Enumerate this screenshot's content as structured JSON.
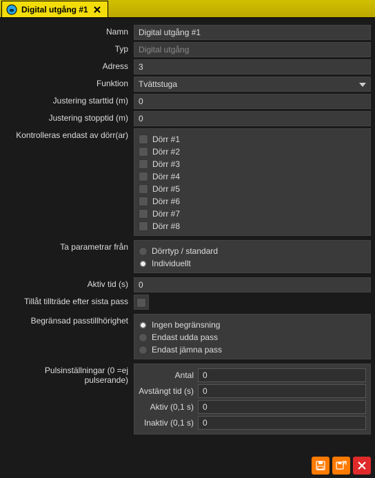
{
  "tab": {
    "title": "Digital utgång #1"
  },
  "labels": {
    "name": "Namn",
    "type": "Typ",
    "address": "Adress",
    "function": "Funktion",
    "adj_start": "Justering starttid (m)",
    "adj_stop": "Justering stopptid (m)",
    "controlled_by": "Kontrolleras endast av dörr(ar)",
    "params_from": "Ta parametrar från",
    "active_time": "Aktiv tid (s)",
    "allow_after_last": "Tillåt tillträde efter sista pass",
    "limited_pass": "Begränsad passtillhörighet",
    "pulse_settings": "Pulsinställningar (0 =ej pulserande)"
  },
  "fields": {
    "name": "Digital utgång #1",
    "type": "Digital utgång",
    "address": "3",
    "function": "Tvättstuga",
    "adj_start": "0",
    "adj_stop": "0",
    "active_time": "0"
  },
  "doors": [
    {
      "label": "Dörr #1",
      "checked": false
    },
    {
      "label": "Dörr #2",
      "checked": false
    },
    {
      "label": "Dörr #3",
      "checked": false
    },
    {
      "label": "Dörr #4",
      "checked": false
    },
    {
      "label": "Dörr #5",
      "checked": false
    },
    {
      "label": "Dörr #6",
      "checked": false
    },
    {
      "label": "Dörr #7",
      "checked": false
    },
    {
      "label": "Dörr #8",
      "checked": false
    }
  ],
  "params_from": {
    "options": [
      {
        "label": "Dörrtyp / standard",
        "selected": false
      },
      {
        "label": "Individuellt",
        "selected": true
      }
    ]
  },
  "limited_pass": {
    "options": [
      {
        "label": "Ingen begränsning",
        "selected": true
      },
      {
        "label": "Endast udda pass",
        "selected": false
      },
      {
        "label": "Endast jämna pass",
        "selected": false
      }
    ]
  },
  "pulse": {
    "labels": {
      "count": "Antal",
      "off": "Avstängt tid (s)",
      "active": "Aktiv (0,1 s)",
      "inactive": "Inaktiv (0,1 s)"
    },
    "values": {
      "count": "0",
      "off": "0",
      "active": "0",
      "inactive": "0"
    }
  },
  "icons": {
    "app": "app-icon",
    "close": "close-icon",
    "caret": "chevron-down-icon",
    "save": "save-icon",
    "saveclose": "save-close-icon",
    "cancel": "cancel-icon"
  }
}
